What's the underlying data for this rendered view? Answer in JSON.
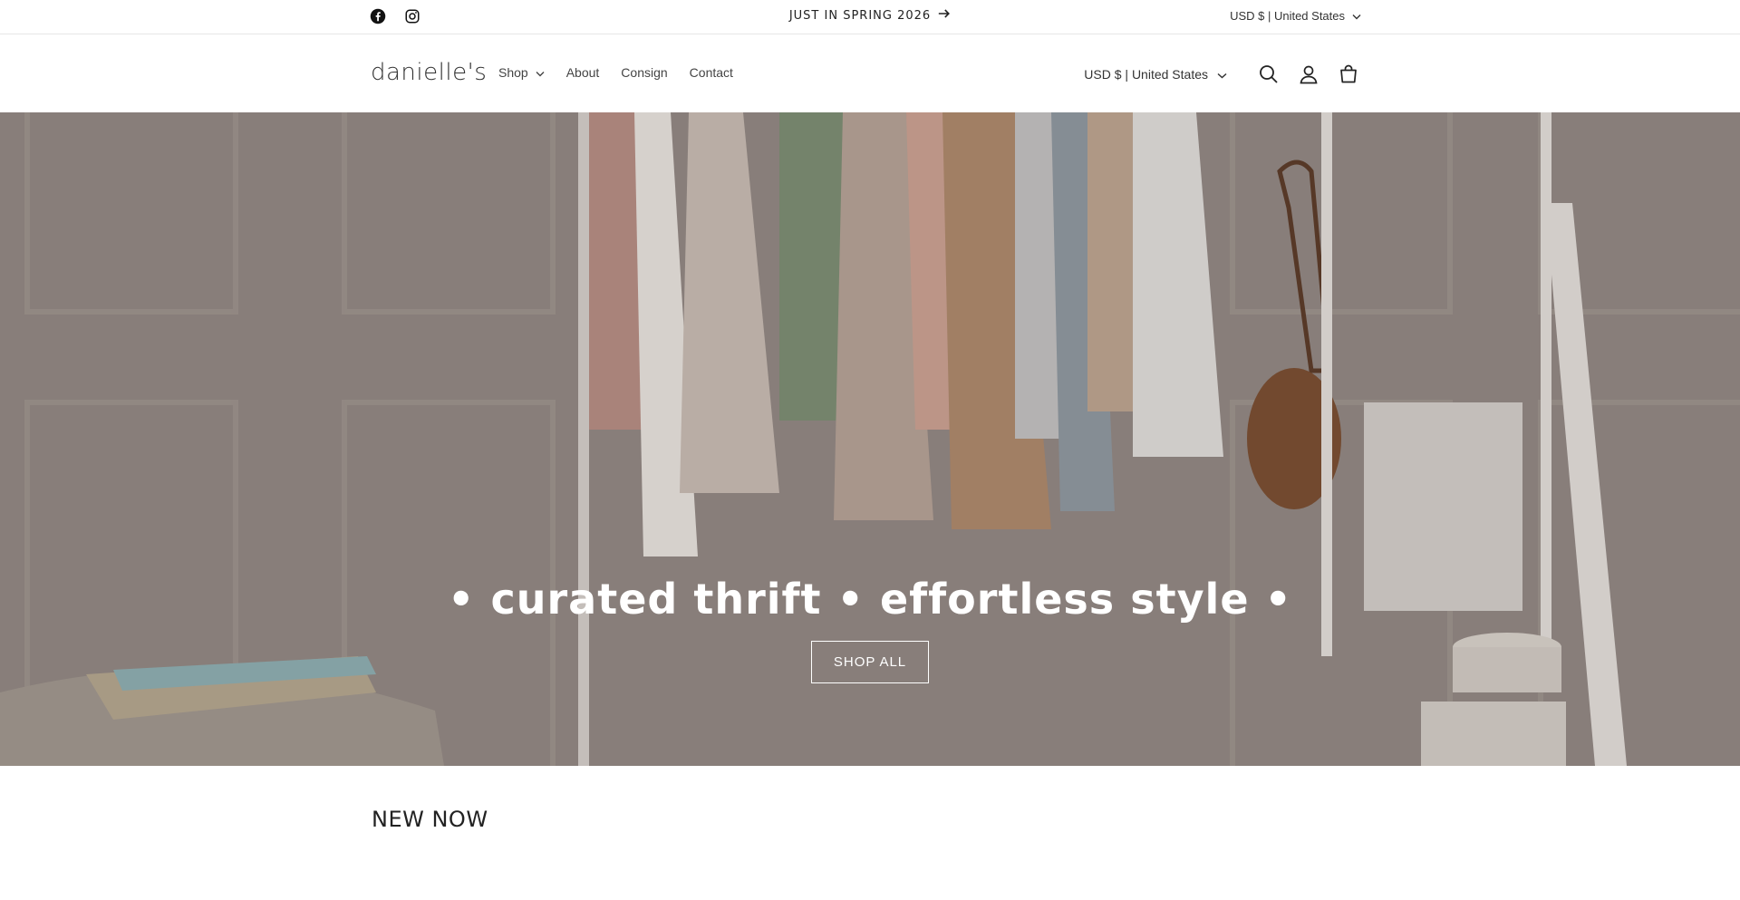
{
  "announcement": {
    "social": [
      {
        "icon": "facebook-icon"
      },
      {
        "icon": "instagram-icon"
      }
    ],
    "message": "JUST IN SPRING 2026",
    "currency": "USD $ | United States"
  },
  "header": {
    "logo": "danielle's",
    "nav": [
      {
        "label": "Shop",
        "has_dropdown": true
      },
      {
        "label": "About"
      },
      {
        "label": "Consign"
      },
      {
        "label": "Contact"
      }
    ],
    "currency": "USD $ | United States",
    "icons": [
      "search-icon",
      "account-icon",
      "cart-icon"
    ]
  },
  "hero": {
    "title": "• curated thrift • effortless style •",
    "button_label": "SHOP ALL"
  },
  "section": {
    "title": "NEW NOW"
  },
  "colors": {
    "background": "#ffffff",
    "text": "#121212",
    "hero_overlay_text": "#ffffff"
  }
}
